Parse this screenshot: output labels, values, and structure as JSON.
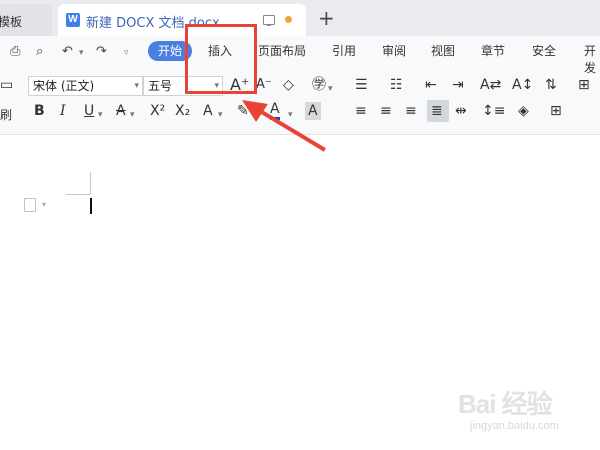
{
  "tabs": {
    "left_tab_label": "模板",
    "active_tab_title": "新建 DOCX 文档.docx",
    "new_tab_symbol": "+"
  },
  "ribbon": {
    "menus": [
      "开始",
      "插入",
      "页面布局",
      "引用",
      "审阅",
      "视图",
      "章节",
      "安全",
      "开发"
    ],
    "font_name": "宋体 (正文)",
    "font_size": "五号",
    "side_label": "刷"
  },
  "watermark": {
    "main": "Bai 经验",
    "sub": "jingyan.baidu.com"
  },
  "colors": {
    "accent": "#4a7fe0",
    "highlight": "#ea4335"
  }
}
